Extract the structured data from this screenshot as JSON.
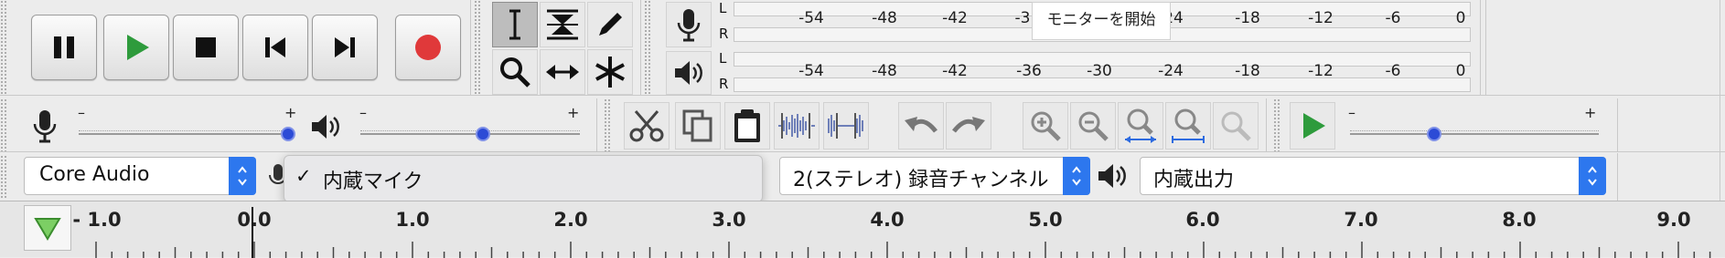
{
  "transport": {
    "pause": "pause",
    "play": "play",
    "stop": "stop",
    "skip_start": "skip-to-start",
    "skip_end": "skip-to-end",
    "record": "record"
  },
  "meters": {
    "record": {
      "L": "L",
      "R": "R",
      "ticks": [
        "-54",
        "-48",
        "-42",
        "-3",
        "-24",
        "-18",
        "-12",
        "-6",
        "0"
      ],
      "monitor_label": "モニターを開始"
    },
    "playback": {
      "L": "L",
      "R": "R",
      "ticks": [
        "-54",
        "-48",
        "-42",
        "-36",
        "-30",
        "-24",
        "-18",
        "-12",
        "-6",
        "0"
      ]
    }
  },
  "mixer": {
    "rec_minus": "–",
    "rec_plus": "+",
    "rec_level": 0.97,
    "play_minus": "–",
    "play_plus": "+",
    "play_level": 0.56,
    "speed_minus": "–",
    "speed_plus": "+",
    "speed_level": 0.34
  },
  "device": {
    "host": "Core Audio",
    "rec_device": "内蔵マイク",
    "rec_device_check": "✓",
    "channels": "2(ステレオ) 録音チャンネル",
    "playback_device": "内蔵出力"
  },
  "ruler": {
    "labels": [
      "- 1.0",
      "0.0",
      "1.0",
      "2.0",
      "3.0",
      "4.0",
      "5.0",
      "6.0",
      "7.0",
      "8.0",
      "9.0"
    ]
  },
  "colors": {
    "accent": "#2d77ee",
    "play_green": "#2e9b3c",
    "record_red": "#e0393a"
  }
}
